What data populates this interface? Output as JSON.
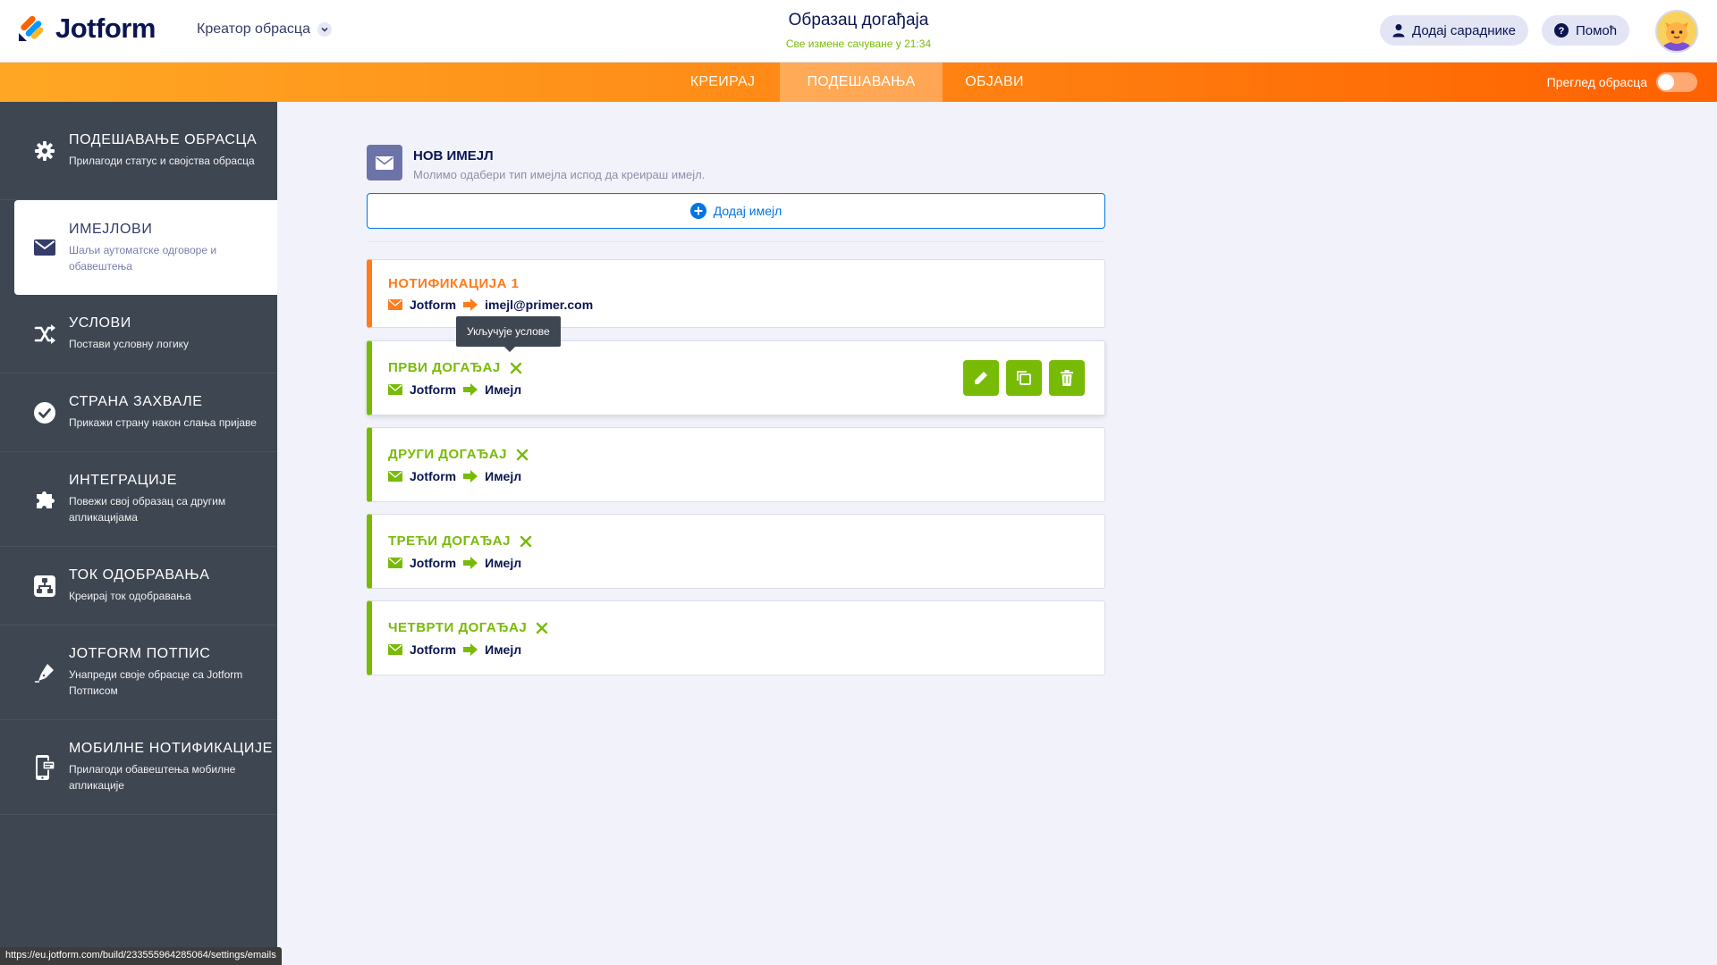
{
  "header": {
    "brand": "Jotform",
    "builder_label": "Креатор обрасца",
    "form_title": "Образац догађаја",
    "saved_status": "Све измене сачуване у 21:34",
    "add_collaborators": "Додај сараднике",
    "help": "Помоћ"
  },
  "tabs": [
    {
      "label": "КРЕИРАЈ",
      "active": false
    },
    {
      "label": "ПОДЕШАВАЊА",
      "active": true
    },
    {
      "label": "ОБЈАВИ",
      "active": false
    }
  ],
  "preview": {
    "label": "Преглед обрасца",
    "enabled": false
  },
  "sidebar": {
    "items": [
      {
        "title": "ПОДЕШАВАЊЕ ОБРАСЦА",
        "desc": "Прилагоди статус и својства обрасца",
        "icon": "gear-icon"
      },
      {
        "title": "ИМЕЈЛОВИ",
        "desc": "Шаљи аутоматске одговоре и обавештења",
        "icon": "envelope-icon",
        "active": true
      },
      {
        "title": "УСЛОВИ",
        "desc": "Постави условну логику",
        "icon": "shuffle-icon"
      },
      {
        "title": "СТРАНА ЗАХВАЛЕ",
        "desc": "Прикажи страну након слања пријаве",
        "icon": "check-circle-icon"
      },
      {
        "title": "ИНТЕГРАЦИЈЕ",
        "desc": "Повежи свој образац са другим апликацијама",
        "icon": "puzzle-icon"
      },
      {
        "title": "ТОК ОДОБРАВАЊА",
        "desc": "Креирај ток одобравања",
        "icon": "flow-icon"
      },
      {
        "title": "JOTFORM ПОТПИС",
        "desc": "Унапреди своје обрасце са Jotform Потписом",
        "icon": "pen-icon"
      },
      {
        "title": "МОБИЛНЕ НОТИФИКАЦИЈЕ",
        "desc": "Прилагоди обавештења мобилне апликације",
        "icon": "mobile-icon"
      }
    ]
  },
  "new_email": {
    "title": "НОВ ИМЕЈЛ",
    "subtitle": "Молимо одабери тип имејла испод да креираш имејл.",
    "add_button": "Додај имејл"
  },
  "emails": [
    {
      "name": "НОТИФИКАЦИЈА 1",
      "from": "Jotform",
      "to": "imejl@primer.com",
      "color": "#ff7b1c",
      "has_conditions": false
    },
    {
      "name": "ПРВИ ДОГАЂАЈ",
      "from": "Jotform",
      "to": "Имејл",
      "color": "#78bb07",
      "has_conditions": true
    },
    {
      "name": "ДРУГИ ДОГАЂАЈ",
      "from": "Jotform",
      "to": "Имејл",
      "color": "#78bb07",
      "has_conditions": true
    },
    {
      "name": "ТРЕЋИ ДОГАЂАЈ",
      "from": "Jotform",
      "to": "Имејл",
      "color": "#78bb07",
      "has_conditions": true
    },
    {
      "name": "ЧЕТВРТИ ДОГАЂАЈ",
      "from": "Jotform",
      "to": "Имејл",
      "color": "#78bb07",
      "has_conditions": true
    }
  ],
  "tooltip": "Укључује услове",
  "status_url": "https://eu.jotform.com/build/233555964285064/settings/emails",
  "colors": {
    "accent_orange": "#ff8e18",
    "green": "#78bb07",
    "blue": "#0075e3",
    "sidebar": "#3e4652"
  }
}
